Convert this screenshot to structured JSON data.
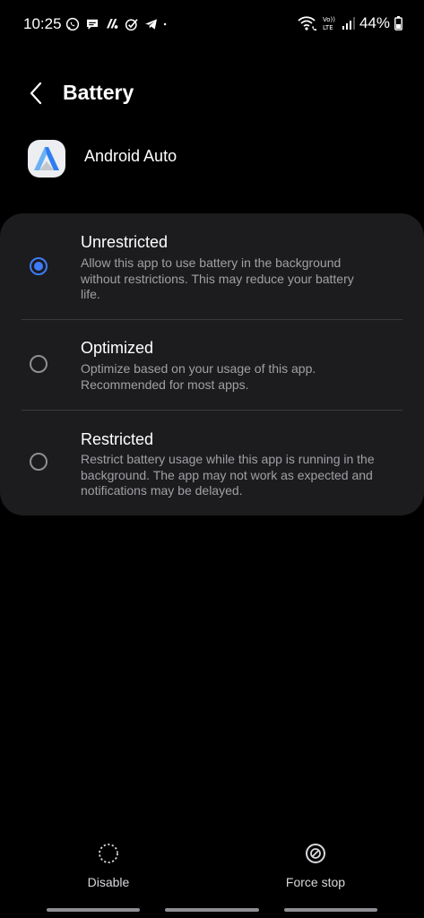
{
  "status_bar": {
    "time": "10:25",
    "battery_percent": "44%",
    "left_icons": [
      "whatsapp-icon",
      "chat-bubble-icon",
      "app-notification-icon",
      "check-circle-icon",
      "telegram-icon",
      "dot-icon"
    ],
    "right_icons": [
      "wifi-calling-icon",
      "volte-icon",
      "signal-icon",
      "battery-icon"
    ]
  },
  "header": {
    "title": "Battery",
    "back_icon": "chevron-left-icon"
  },
  "app": {
    "name": "Android Auto",
    "icon": "android-auto-icon"
  },
  "options": [
    {
      "title": "Unrestricted",
      "description": "Allow this app to use battery in the background without restrictions. This may reduce your battery life.",
      "selected": true
    },
    {
      "title": "Optimized",
      "description": "Optimize based on your usage of this app. Recommended for most apps.",
      "selected": false
    },
    {
      "title": "Restricted",
      "description": "Restrict battery usage while this app is running in the background. The app may not work as expected and notifications may be delayed.",
      "selected": false
    }
  ],
  "bottom_actions": {
    "disable_label": "Disable",
    "force_stop_label": "Force stop"
  },
  "colors": {
    "background": "#000000",
    "card": "#1c1c1e",
    "accent": "#3e7bfa",
    "secondary_text": "#a0a0a5"
  }
}
